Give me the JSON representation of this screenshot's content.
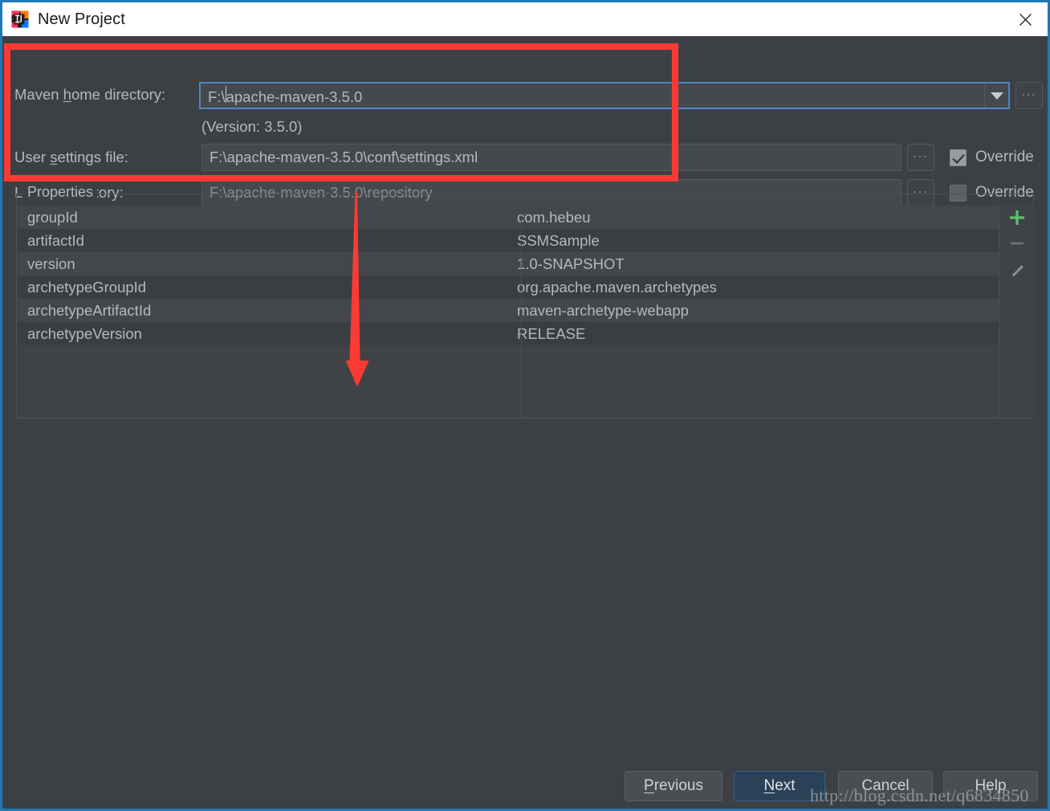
{
  "window": {
    "title": "New Project",
    "logo_icon": "intellij-idea-logo",
    "close_icon": "close-icon",
    "border_color": "#2079b5",
    "titlebar_bg": "#ffffff",
    "dialog_bg": "#3c4045"
  },
  "form": {
    "maven_home": {
      "label_pre": "Maven ",
      "label_mnemonic": "h",
      "label_post": "ome directory:",
      "value": "F:\\apache-maven-3.5.0",
      "dropdown_icon": "chevron-down-icon",
      "browse_label": "...",
      "focus_color": "#4a88c7"
    },
    "version_note": "(Version: 3.5.0)",
    "user_settings": {
      "label_pre": "User ",
      "label_mnemonic": "s",
      "label_post": "ettings file:",
      "value": "F:\\apache-maven-3.5.0\\conf\\settings.xml",
      "browse_label": "...",
      "override_label": "Override",
      "override_checked": true
    },
    "local_repository": {
      "label_pre": "Local ",
      "label_mnemonic": "r",
      "label_post": "epository:",
      "value": "F:\\apache-maven-3.5.0\\repository",
      "browse_label": "...",
      "override_label": "Override",
      "override_checked": false
    }
  },
  "properties": {
    "legend": "Properties",
    "rows": [
      {
        "key": "groupId",
        "value": "com.hebeu"
      },
      {
        "key": "artifactId",
        "value": "SSMSample"
      },
      {
        "key": "version",
        "value": "1.0-SNAPSHOT"
      },
      {
        "key": "archetypeGroupId",
        "value": "org.apache.maven.archetypes"
      },
      {
        "key": "archetypeArtifactId",
        "value": "maven-archetype-webapp"
      },
      {
        "key": "archetypeVersion",
        "value": "RELEASE"
      }
    ],
    "toolbar": {
      "add_icon": "plus-icon",
      "add_color": "#59c46a",
      "remove_icon": "minus-icon",
      "remove_color": "#6e7276",
      "edit_icon": "pencil-icon",
      "edit_color": "#8a8d90"
    }
  },
  "buttons": {
    "previous": {
      "pre": "",
      "mnemonic": "P",
      "post": "revious",
      "primary": false
    },
    "next": {
      "pre": "",
      "mnemonic": "N",
      "post": "ext",
      "primary": true
    },
    "cancel": {
      "pre": "",
      "mnemonic": "",
      "post": "Cancel",
      "primary": false
    },
    "help": {
      "pre": "",
      "mnemonic": "",
      "post": "Help",
      "primary": false
    }
  },
  "watermark": {
    "text": "http://blog.csdn.net/q6834850"
  },
  "annotations": {
    "highlight_color": "#fb3b33",
    "rectangle_label": "maven-settings-highlight",
    "arrow_label": "properties-pointer-arrow"
  }
}
